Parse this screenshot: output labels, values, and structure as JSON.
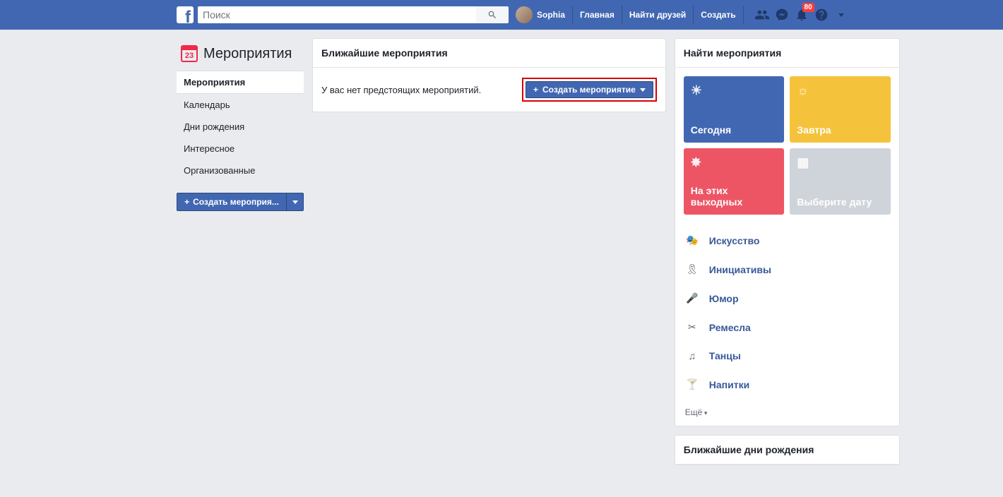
{
  "header": {
    "search_placeholder": "Поиск",
    "profile_name": "Sophia",
    "links": {
      "home": "Главная",
      "friends": "Найти друзей",
      "create": "Создать"
    },
    "notif_count": "80"
  },
  "left": {
    "title": "Мероприятия",
    "cal_day": "23",
    "menu": [
      "Мероприятия",
      "Календарь",
      "Дни рождения",
      "Интересное",
      "Организованные"
    ],
    "active_index": 0,
    "create_label": "Создать мероприя..."
  },
  "center": {
    "header": "Ближайшие мероприятия",
    "empty_msg": "У вас нет предстоящих мероприятий.",
    "create_label": "Создать мероприятие"
  },
  "right": {
    "find_header": "Найти мероприятия",
    "tiles": {
      "today": "Сегодня",
      "tomorrow": "Завтра",
      "weekend": "На этих выходных",
      "pick": "Выберите дату"
    },
    "categories": [
      {
        "icon": "🎭",
        "label": "Искусство"
      },
      {
        "icon": "🎗",
        "label": "Инициативы"
      },
      {
        "icon": "🎤",
        "label": "Юмор"
      },
      {
        "icon": "✂",
        "label": "Ремесла"
      },
      {
        "icon": "♫",
        "label": "Танцы"
      },
      {
        "icon": "🍸",
        "label": "Напитки"
      }
    ],
    "more": "Ещё",
    "bdays_header": "Ближайшие дни рождения"
  }
}
